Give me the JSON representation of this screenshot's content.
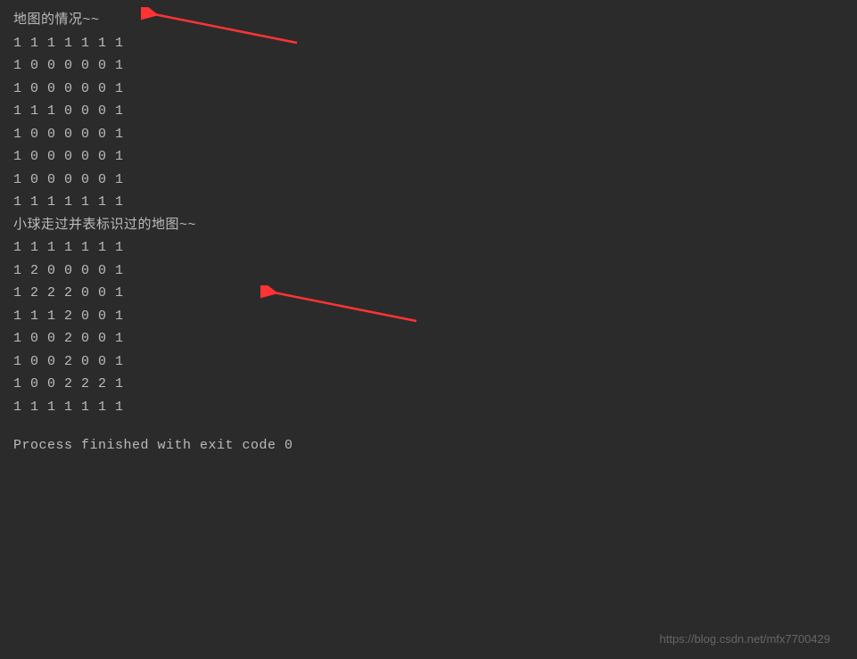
{
  "section1": {
    "header": "地图的情况~~",
    "rows": [
      "1 1 1 1 1 1 1",
      "1 0 0 0 0 0 1",
      "1 0 0 0 0 0 1",
      "1 1 1 0 0 0 1",
      "1 0 0 0 0 0 1",
      "1 0 0 0 0 0 1",
      "1 0 0 0 0 0 1",
      "1 1 1 1 1 1 1"
    ]
  },
  "section2": {
    "header": "小球走过并表标识过的地图~~",
    "rows": [
      "1 1 1 1 1 1 1",
      "1 2 0 0 0 0 1",
      "1 2 2 2 0 0 1",
      "1 1 1 2 0 0 1",
      "1 0 0 2 0 0 1",
      "1 0 0 2 0 0 1",
      "1 0 0 2 2 2 1",
      "1 1 1 1 1 1 1"
    ]
  },
  "process_message": "Process finished with exit code 0",
  "watermark": "https://blog.csdn.net/mfx7700429"
}
